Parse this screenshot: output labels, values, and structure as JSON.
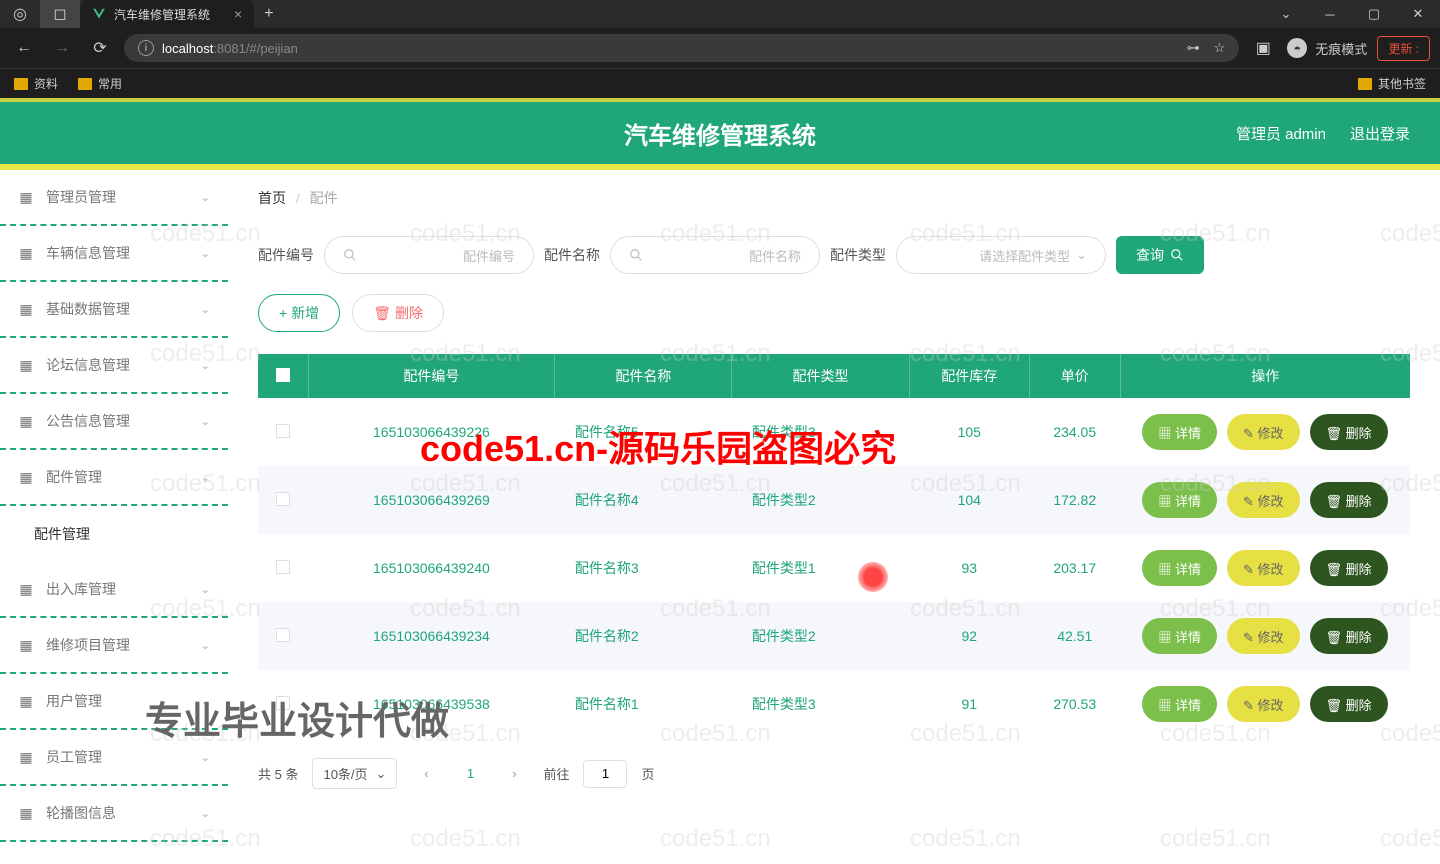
{
  "browser": {
    "tab_title": "汽车维修管理系统",
    "url_host": "localhost",
    "url_port": ":8081",
    "url_path": "/#/peijian",
    "incognito": "无痕模式",
    "update": "更新",
    "bookmarks": [
      "资料",
      "常用"
    ],
    "other_bookmarks": "其他书签"
  },
  "header": {
    "title": "汽车维修管理系统",
    "user": "管理员 admin",
    "logout": "退出登录"
  },
  "sidebar": {
    "items": [
      {
        "label": "管理员管理"
      },
      {
        "label": "车辆信息管理"
      },
      {
        "label": "基础数据管理"
      },
      {
        "label": "论坛信息管理"
      },
      {
        "label": "公告信息管理"
      },
      {
        "label": "配件管理"
      },
      {
        "label": "配件管理",
        "active": true
      },
      {
        "label": "出入库管理"
      },
      {
        "label": "维修项目管理"
      },
      {
        "label": "用户管理"
      },
      {
        "label": "员工管理"
      },
      {
        "label": "轮播图信息"
      }
    ]
  },
  "breadcrumb": {
    "home": "首页",
    "current": "配件"
  },
  "search": {
    "code_label": "配件编号",
    "code_placeholder": "配件编号",
    "name_label": "配件名称",
    "name_placeholder": "配件名称",
    "type_label": "配件类型",
    "type_placeholder": "请选择配件类型",
    "query": "查询"
  },
  "actions": {
    "add": "新增",
    "delete": "删除"
  },
  "table": {
    "headers": [
      "配件编号",
      "配件名称",
      "配件类型",
      "配件库存",
      "单价",
      "操作"
    ],
    "rows": [
      {
        "code": "165103066439226",
        "name": "配件名称5",
        "type": "配件类型3",
        "stock": "105",
        "price": "234.05"
      },
      {
        "code": "165103066439269",
        "name": "配件名称4",
        "type": "配件类型2",
        "stock": "104",
        "price": "172.82"
      },
      {
        "code": "165103066439240",
        "name": "配件名称3",
        "type": "配件类型1",
        "stock": "93",
        "price": "203.17"
      },
      {
        "code": "165103066439234",
        "name": "配件名称2",
        "type": "配件类型2",
        "stock": "92",
        "price": "42.51"
      },
      {
        "code": "165103066439538",
        "name": "配件名称1",
        "type": "配件类型3",
        "stock": "91",
        "price": "270.53"
      }
    ],
    "row_actions": {
      "detail": "详情",
      "edit": "修改",
      "delete": "删除"
    }
  },
  "pagination": {
    "total": "共 5 条",
    "per_page": "10条/页",
    "current": "1",
    "goto": "前往",
    "goto_value": "1",
    "page_unit": "页"
  },
  "overlays": {
    "watermark": "code51.cn",
    "red_text": "code51.cn-源码乐园盗图必究",
    "gray_text": "专业毕业设计代做"
  }
}
